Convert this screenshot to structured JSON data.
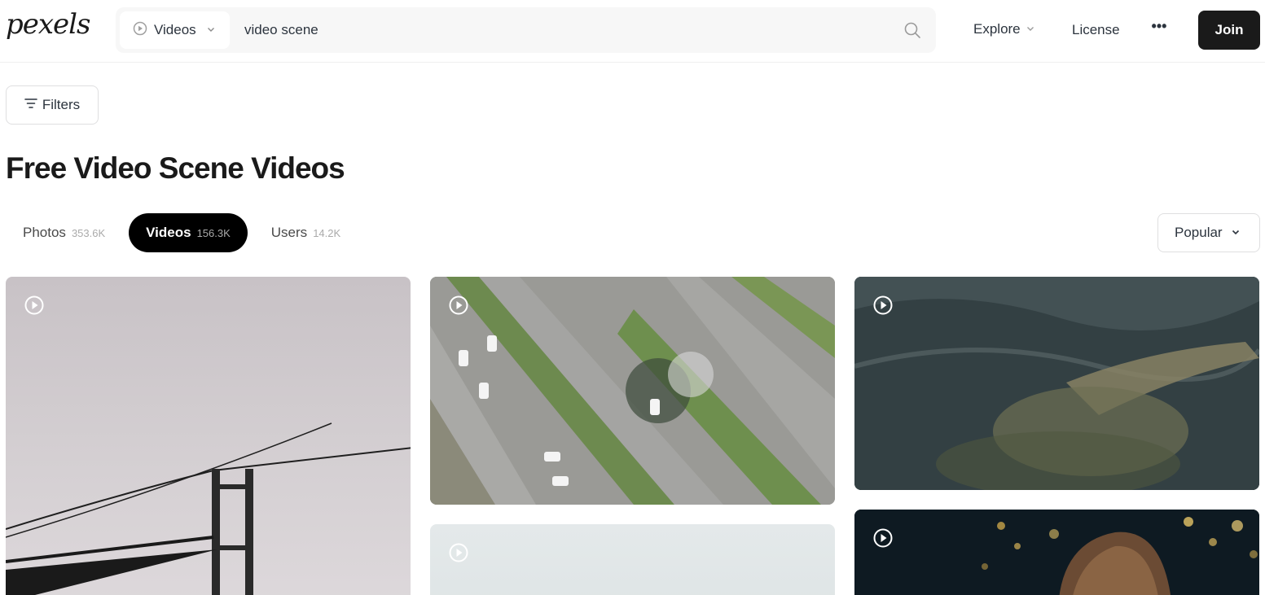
{
  "header": {
    "logo": "pexels",
    "search_type": "Videos",
    "search_value": "video scene",
    "nav_explore": "Explore",
    "nav_license": "License",
    "nav_more": "•••",
    "join": "Join"
  },
  "filters": {
    "label": "Filters"
  },
  "page_title": "Free Video Scene Videos",
  "tabs": [
    {
      "label": "Photos",
      "count": "353.6K",
      "active": false
    },
    {
      "label": "Videos",
      "count": "156.3K",
      "active": true
    },
    {
      "label": "Users",
      "count": "14.2K",
      "active": false
    }
  ],
  "sort": {
    "label": "Popular"
  },
  "colors": {
    "primary_dark": "#1a1a1a",
    "active_tab": "#000000",
    "search_bg": "#f7f7f7"
  },
  "icons": [
    "play-circle-icon",
    "chevron-down-icon",
    "search-icon",
    "more-icon",
    "filter-icon"
  ]
}
